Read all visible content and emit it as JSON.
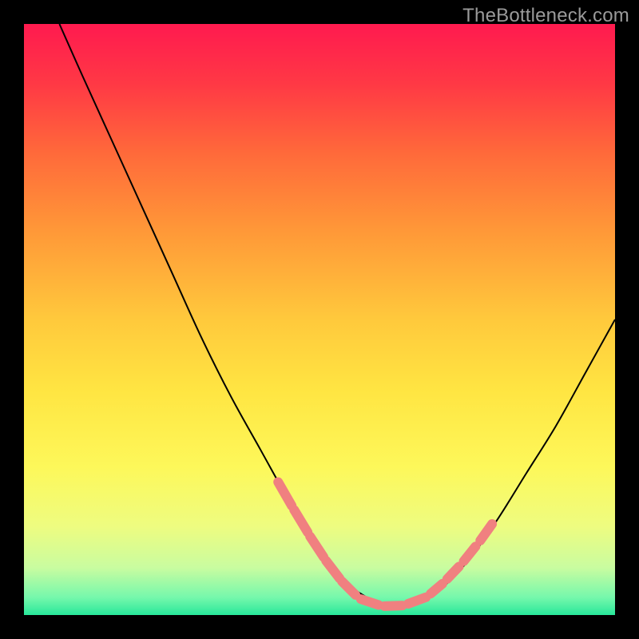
{
  "watermark": {
    "text": "TheBottleneck.com"
  },
  "gradient": {
    "stops": [
      {
        "offset": 0.0,
        "color": "#ff1a4f"
      },
      {
        "offset": 0.1,
        "color": "#ff3845"
      },
      {
        "offset": 0.22,
        "color": "#ff6a3a"
      },
      {
        "offset": 0.35,
        "color": "#ff9838"
      },
      {
        "offset": 0.5,
        "color": "#ffc93c"
      },
      {
        "offset": 0.62,
        "color": "#ffe542"
      },
      {
        "offset": 0.75,
        "color": "#fdf85a"
      },
      {
        "offset": 0.85,
        "color": "#eefc80"
      },
      {
        "offset": 0.92,
        "color": "#c9fca0"
      },
      {
        "offset": 0.97,
        "color": "#76f8ac"
      },
      {
        "offset": 1.0,
        "color": "#28e79a"
      }
    ]
  },
  "chart_data": {
    "type": "line",
    "title": "",
    "xlabel": "",
    "ylabel": "",
    "xlim": [
      0,
      100
    ],
    "ylim": [
      0,
      100
    ],
    "series": [
      {
        "name": "curve",
        "x": [
          6,
          10,
          15,
          20,
          25,
          30,
          35,
          40,
          45,
          48,
          50,
          52,
          55,
          58,
          60,
          62,
          64,
          66,
          70,
          75,
          80,
          85,
          90,
          95,
          100
        ],
        "y": [
          100,
          91,
          80,
          69,
          58,
          47,
          37,
          28,
          19,
          14,
          11,
          8,
          5,
          3,
          2,
          1.5,
          1.5,
          2,
          4,
          9,
          16,
          24,
          32,
          41,
          50
        ]
      }
    ],
    "highlight_segments": [
      {
        "x": [
          43,
          45.3
        ],
        "y": [
          22.5,
          18.5
        ]
      },
      {
        "x": [
          45.7,
          48
        ],
        "y": [
          17.8,
          14
        ]
      },
      {
        "x": [
          48.4,
          50.7
        ],
        "y": [
          13.3,
          9.8
        ]
      },
      {
        "x": [
          51.1,
          53.4
        ],
        "y": [
          9.2,
          6.2
        ]
      },
      {
        "x": [
          53.8,
          56.1
        ],
        "y": [
          5.7,
          3.4
        ]
      },
      {
        "x": [
          57.0,
          60.0
        ],
        "y": [
          2.7,
          1.7
        ]
      },
      {
        "x": [
          61.0,
          64.0
        ],
        "y": [
          1.5,
          1.6
        ]
      },
      {
        "x": [
          65.0,
          68.0
        ],
        "y": [
          1.9,
          3.0
        ]
      },
      {
        "x": [
          68.8,
          70.8
        ],
        "y": [
          3.6,
          5.3
        ]
      },
      {
        "x": [
          71.6,
          73.6
        ],
        "y": [
          6.1,
          8.2
        ]
      },
      {
        "x": [
          74.4,
          76.4
        ],
        "y": [
          9.1,
          11.6
        ]
      },
      {
        "x": [
          77.2,
          79.2
        ],
        "y": [
          12.6,
          15.4
        ]
      }
    ],
    "highlight_color": "#f08080"
  }
}
